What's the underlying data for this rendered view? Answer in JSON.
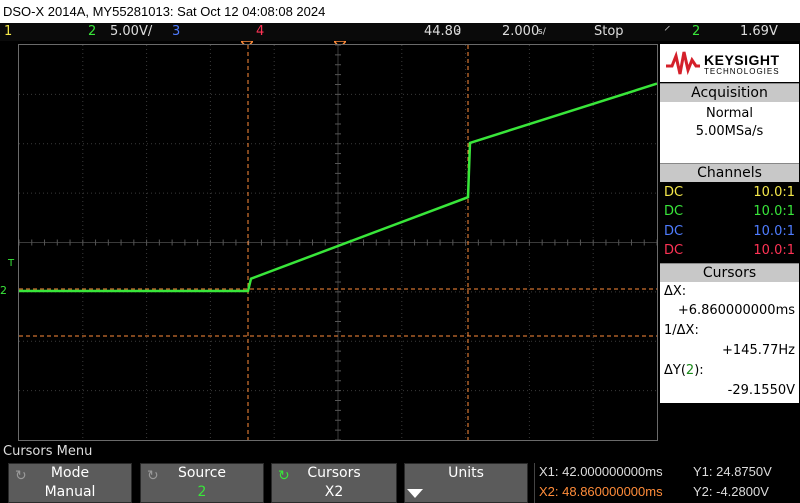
{
  "title": "DSO-X 2014A, MY55281013: Sat Oct 12 04:08:08 2024",
  "status": {
    "ch1": "1",
    "ch2": "2",
    "ch2_scale": "5.00V/",
    "ch3": "3",
    "ch4": "4",
    "time_delay": "44.80",
    "time_delay_unit": "s",
    "time_scale": "2.000",
    "time_scale_unit": "s/",
    "run_state": "Stop",
    "trigger_icon": "rising-edge-trigger",
    "trigger_source": "2",
    "trigger_level": "1.69V"
  },
  "colors": {
    "ch1": "#f5e84a",
    "ch2": "#39e63a",
    "ch3": "#4f7cff",
    "ch4": "#ff3355",
    "cursor": "#ff8c3a",
    "grid": "#3a3a3a"
  },
  "markers": {
    "trigger": "T",
    "ch2": "2"
  },
  "brand": {
    "name": "KEYSIGHT",
    "sub": "TECHNOLOGIES"
  },
  "acquisition": {
    "header": "Acquisition",
    "mode": "Normal",
    "rate": "5.00MSa/s"
  },
  "channels": {
    "header": "Channels",
    "rows": [
      {
        "coupling": "DC",
        "probe": "10.0:1"
      },
      {
        "coupling": "DC",
        "probe": "10.0:1"
      },
      {
        "coupling": "DC",
        "probe": "10.0:1"
      },
      {
        "coupling": "DC",
        "probe": "10.0:1"
      }
    ]
  },
  "cursors": {
    "header": "Cursors",
    "dx_label": "ΔX:",
    "dx_value": "+6.860000000ms",
    "inv_dx_label": "1/ΔX:",
    "inv_dx_value": "+145.77Hz",
    "dy_label_prefix": "ΔY(",
    "dy_channel": "2",
    "dy_label_suffix": "):",
    "dy_value": "-29.1550V"
  },
  "menu": {
    "title": "Cursors Menu",
    "softkeys": [
      {
        "label": "Mode",
        "value": "Manual"
      },
      {
        "label": "Source",
        "value": "2"
      },
      {
        "label": "Cursors",
        "value": "X2"
      },
      {
        "label": "Units",
        "value": ""
      }
    ]
  },
  "readout": {
    "x1": "X1: 42.000000000ms",
    "x2": "X2: 48.860000000ms",
    "y1": "Y1: 24.8750V",
    "y2": "Y2: -4.2800V"
  },
  "trace_levels": {
    "flat": 0,
    "step_start": 0.25,
    "step1_end": 1.9,
    "step2_start": 3.0,
    "end": 4.2
  }
}
